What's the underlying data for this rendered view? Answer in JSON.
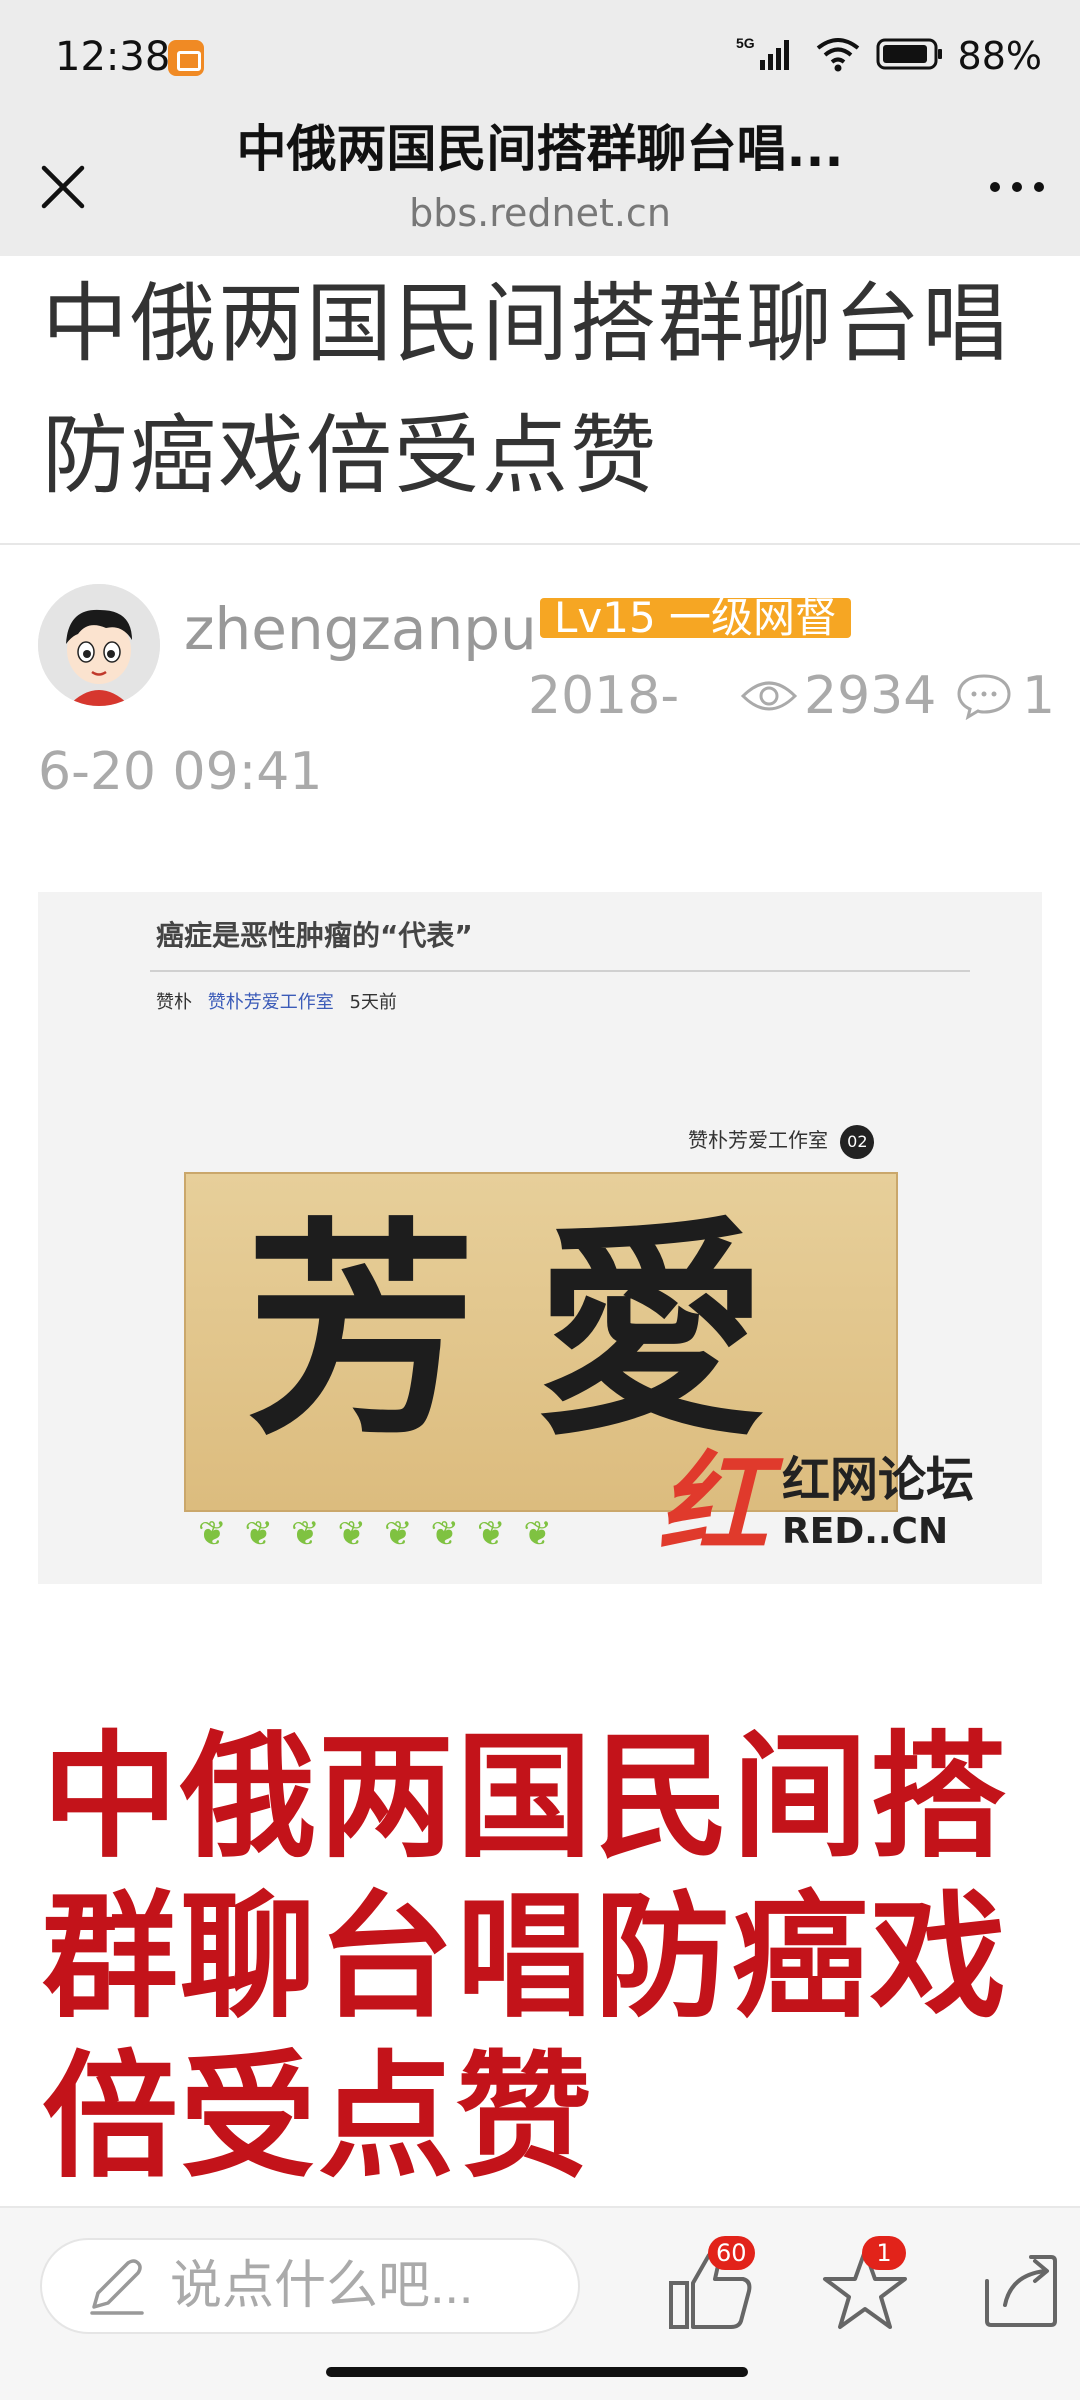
{
  "status_bar": {
    "time": "12:38",
    "network": "5G",
    "battery": "88%"
  },
  "header": {
    "title": "中俄两国民间搭群聊台唱...",
    "domain": "bbs.rednet.cn",
    "close_icon": "close-icon",
    "more_icon": "more-icon"
  },
  "article": {
    "title": "中俄两国民间搭群聊台唱防癌戏倍受点赞",
    "author": "zhengzanpu",
    "level": "Lv15 一级网督",
    "date_part1": "2018-",
    "date_part2": "6-20 09:41",
    "views": "2934",
    "comments": "1",
    "headline": "中俄两国民间搭群聊台唱防癌戏倍受点赞"
  },
  "image": {
    "caption": "癌症是恶性肿瘤的“代表”",
    "meta_author": "赞朴",
    "meta_studio": "赞朴芳爱工作室",
    "meta_time": "5天前",
    "studio_label": "赞朴芳爱工作室",
    "studio_num": "02",
    "board_text": "芳愛",
    "logo_mark": "红",
    "logo_name": "红网论坛",
    "logo_url": "RED..CN"
  },
  "bottom_bar": {
    "comment_placeholder": "说点什么吧...",
    "like_count": "60",
    "favorite_count": "1"
  },
  "colors": {
    "accent_red": "#c3131a",
    "badge_orange": "#f6a623",
    "badge_red": "#e2231a"
  }
}
